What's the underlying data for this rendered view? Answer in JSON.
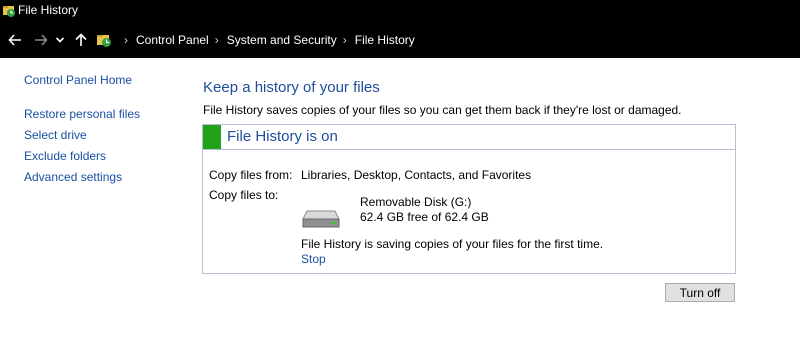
{
  "window": {
    "title": "File History",
    "title_icon": "file-history-icon"
  },
  "navigation": {
    "back_icon": "back-arrow-icon",
    "forward_icon": "forward-arrow-icon",
    "recent_icon": "chevron-down-icon",
    "up_icon": "up-arrow-icon",
    "breadcrumbs": [
      "Control Panel",
      "System and Security",
      "File History"
    ],
    "breadcrumb_separator": "›"
  },
  "sidebar": {
    "home": "Control Panel Home",
    "links": [
      "Restore personal files",
      "Select drive",
      "Exclude folders",
      "Advanced settings"
    ]
  },
  "main": {
    "title": "Keep a history of your files",
    "description": "File History saves copies of your files so you can get them back if they're lost or damaged.",
    "status": {
      "title": "File History is on",
      "color": "#21a21a"
    },
    "copy_from_label": "Copy files from:",
    "copy_from_value": "Libraries, Desktop, Contacts, and Favorites",
    "copy_to_label": "Copy files to:",
    "drive": {
      "icon": "removable-drive-icon",
      "name": "Removable Disk (G:)",
      "space": "62.4 GB free of 62.4 GB"
    },
    "progress_message": "File History is saving copies of your files for the first time.",
    "stop_label": "Stop",
    "turn_off_label": "Turn off"
  },
  "colors": {
    "link": "#1a4fa3",
    "heading": "#1f4e9c",
    "titlebar": "#000000"
  }
}
